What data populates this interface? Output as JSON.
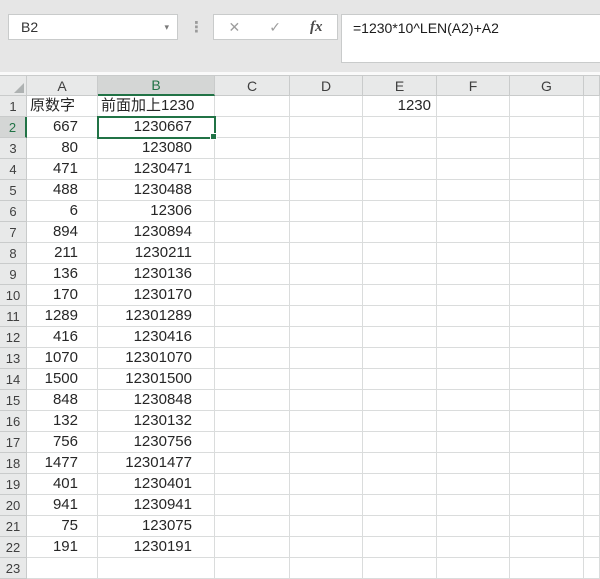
{
  "formula_bar": {
    "name_box_value": "B2",
    "name_box_dropdown_icon": "▾",
    "dots_icon": "⋮",
    "cancel_icon": "✕",
    "enter_icon": "✓",
    "insert_function_icon": "fx",
    "formula": "=1230*10^LEN(A2)+A2"
  },
  "grid": {
    "selected_cell": "B2",
    "selected_column": "B",
    "selected_row": "2",
    "column_headers": [
      "A",
      "B",
      "C",
      "D",
      "E",
      "F",
      "G",
      ""
    ],
    "row_headers": [
      "1",
      "2",
      "3",
      "4",
      "5",
      "6",
      "7",
      "8",
      "9",
      "10",
      "11",
      "12",
      "13",
      "14",
      "15",
      "16",
      "17",
      "18",
      "19",
      "20",
      "21",
      "22",
      "23"
    ],
    "cells": {
      "A1": "原数字",
      "B1": "前面加上1230",
      "E1": "1230"
    },
    "columns_data_start_row": 2,
    "columns_data": {
      "A": [
        "667",
        "80",
        "471",
        "488",
        "6",
        "894",
        "211",
        "136",
        "170",
        "1289",
        "416",
        "1070",
        "1500",
        "848",
        "132",
        "756",
        "1477",
        "401",
        "941",
        "75",
        "191"
      ],
      "B": [
        "1230667",
        "123080",
        "1230471",
        "1230488",
        "12306",
        "1230894",
        "1230211",
        "1230136",
        "1230170",
        "12301289",
        "1230416",
        "12301070",
        "12301500",
        "1230848",
        "1230132",
        "1230756",
        "12301477",
        "1230401",
        "1230941",
        "123075",
        "1230191"
      ]
    }
  },
  "colors": {
    "accent_green": "#217346",
    "toolbar_bg": "#E6E6E6",
    "header_bg": "#E8E9E9",
    "selected_header_bg": "#D4D6D5",
    "gridline": "#DADCDC",
    "header_border": "#C9CBCB",
    "cell_text": "#262626"
  }
}
